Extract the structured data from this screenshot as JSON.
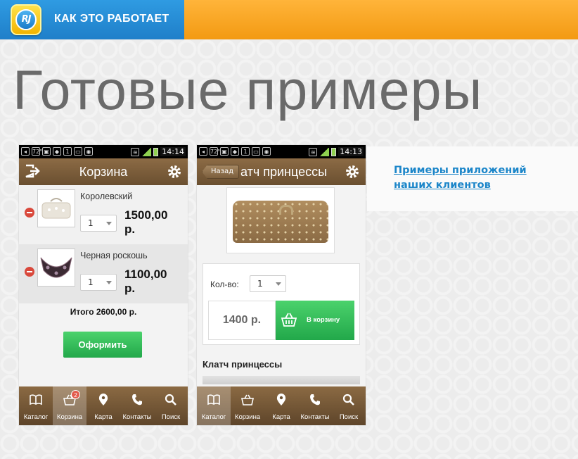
{
  "header": {
    "logo_text": "RJ",
    "nav_link": "КАК ЭТО РАБОТАЕТ"
  },
  "page_title": "Готовые примеры",
  "side_link": "Примеры приложений наших клиентов",
  "phone_cart": {
    "status": {
      "temp": "72°",
      "time": "14:14"
    },
    "title": "Корзина",
    "items": [
      {
        "name": "Королевский",
        "qty": "1",
        "price": "1500,00 р."
      },
      {
        "name": "Черная роскошь",
        "qty": "1",
        "price": "1100,00 р."
      }
    ],
    "total": "Итого  2600,00 р.",
    "checkout_label": "Оформить",
    "tabs": [
      {
        "label": "Каталог",
        "icon": "book-icon"
      },
      {
        "label": "Корзина",
        "icon": "basket-icon",
        "badge": "2",
        "active": true
      },
      {
        "label": "Карта",
        "icon": "map-pin-icon"
      },
      {
        "label": "Контакты",
        "icon": "phone-icon"
      },
      {
        "label": "Поиск",
        "icon": "search-icon"
      }
    ]
  },
  "phone_product": {
    "status": {
      "temp": "72°",
      "time": "14:13"
    },
    "back_label": "Назад",
    "title": "атч принцессы",
    "qty_label": "Кол-во:",
    "qty": "1",
    "price": "1400 р.",
    "add_to_cart": "В корзину",
    "product_title": "Клатч принцессы",
    "tabs": [
      {
        "label": "Каталог",
        "icon": "book-icon",
        "active": true
      },
      {
        "label": "Корзина",
        "icon": "basket-icon"
      },
      {
        "label": "Карта",
        "icon": "map-pin-icon"
      },
      {
        "label": "Контакты",
        "icon": "phone-icon"
      },
      {
        "label": "Поиск",
        "icon": "search-icon"
      }
    ]
  },
  "colors": {
    "header_blue": "#2f9be2",
    "header_orange": "#f39a12",
    "appbar_brown": "#7a5c39",
    "button_green": "#2fb755",
    "link_blue": "#1c86c9"
  }
}
